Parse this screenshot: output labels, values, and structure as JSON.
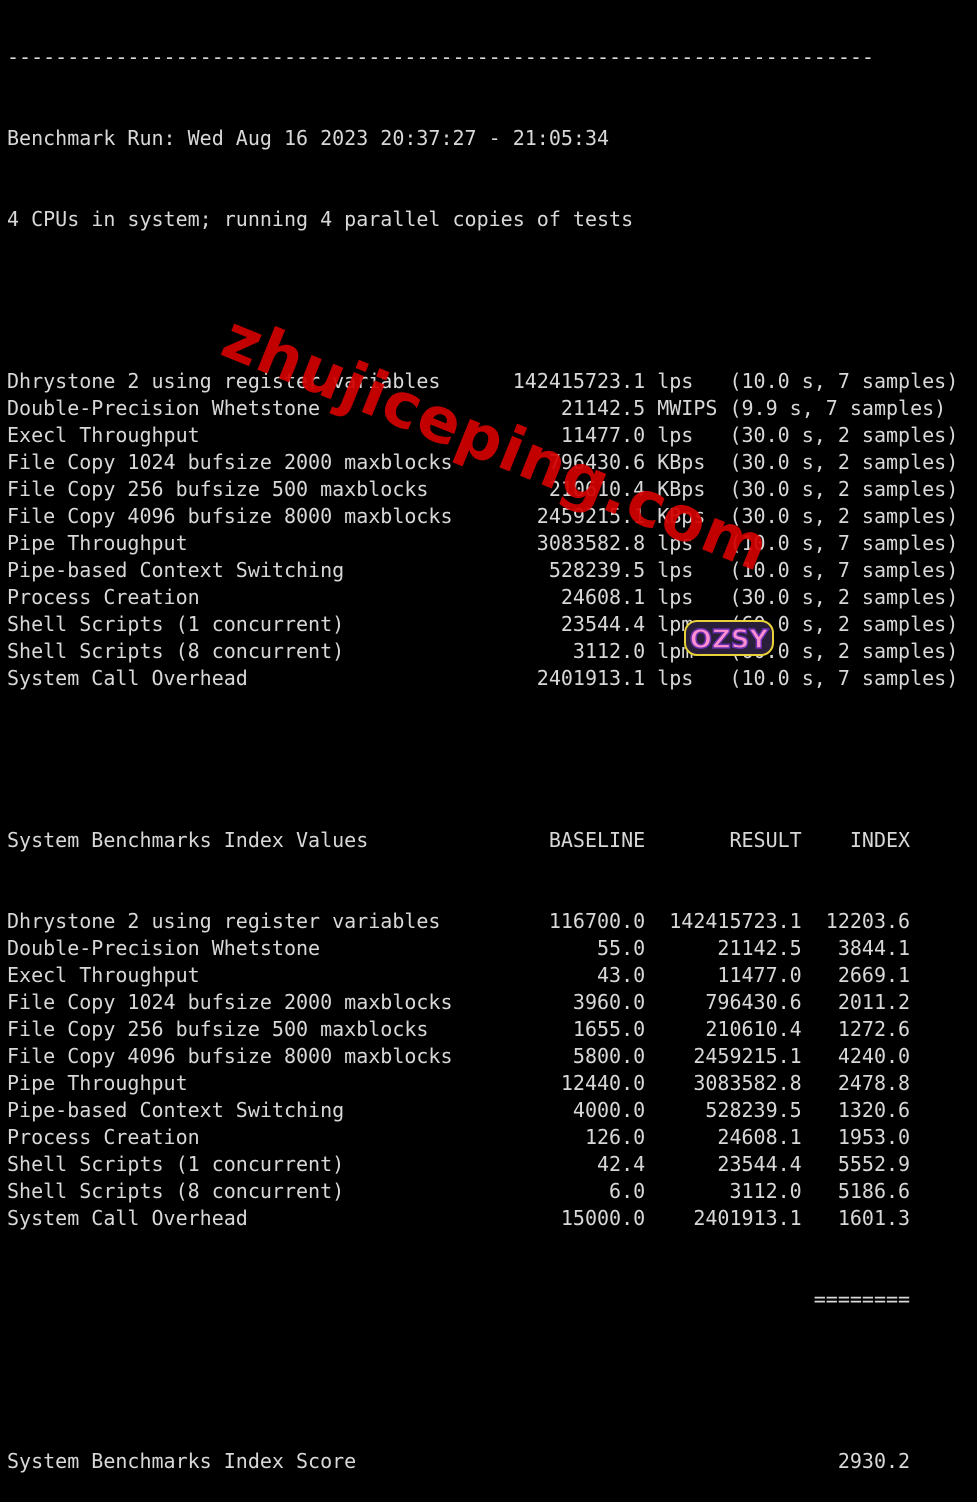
{
  "terminal": {
    "separator": "------------------------------------------------------------------------",
    "header": [
      "Benchmark Run: Wed Aug 16 2023 20:37:27 - 21:05:34",
      "4 CPUs in system; running 4 parallel copies of tests"
    ],
    "results": [
      {
        "name": "Dhrystone 2 using register variables",
        "value": "142415723.1",
        "unit": "lps",
        "info": "(10.0 s, 7 samples)"
      },
      {
        "name": "Double-Precision Whetstone",
        "value": "21142.5",
        "unit": "MWIPS",
        "info": "(9.9 s, 7 samples)"
      },
      {
        "name": "Execl Throughput",
        "value": "11477.0",
        "unit": "lps",
        "info": "(30.0 s, 2 samples)"
      },
      {
        "name": "File Copy 1024 bufsize 2000 maxblocks",
        "value": "796430.6",
        "unit": "KBps",
        "info": "(30.0 s, 2 samples)"
      },
      {
        "name": "File Copy 256 bufsize 500 maxblocks",
        "value": "210610.4",
        "unit": "KBps",
        "info": "(30.0 s, 2 samples)"
      },
      {
        "name": "File Copy 4096 bufsize 8000 maxblocks",
        "value": "2459215.1",
        "unit": "KBps",
        "info": "(30.0 s, 2 samples)"
      },
      {
        "name": "Pipe Throughput",
        "value": "3083582.8",
        "unit": "lps",
        "info": "(10.0 s, 7 samples)"
      },
      {
        "name": "Pipe-based Context Switching",
        "value": "528239.5",
        "unit": "lps",
        "info": "(10.0 s, 7 samples)"
      },
      {
        "name": "Process Creation",
        "value": "24608.1",
        "unit": "lps",
        "info": "(30.0 s, 2 samples)"
      },
      {
        "name": "Shell Scripts (1 concurrent)",
        "value": "23544.4",
        "unit": "lpm",
        "info": "(60.0 s, 2 samples)"
      },
      {
        "name": "Shell Scripts (8 concurrent)",
        "value": "3112.0",
        "unit": "lpm",
        "info": "(60.0 s, 2 samples)"
      },
      {
        "name": "System Call Overhead",
        "value": "2401913.1",
        "unit": "lps",
        "info": "(10.0 s, 7 samples)"
      }
    ],
    "index_title": "System Benchmarks Index Values",
    "index_columns": [
      "BASELINE",
      "RESULT",
      "INDEX"
    ],
    "index_rows": [
      {
        "name": "Dhrystone 2 using register variables",
        "baseline": "116700.0",
        "result": "142415723.1",
        "index": "12203.6"
      },
      {
        "name": "Double-Precision Whetstone",
        "baseline": "55.0",
        "result": "21142.5",
        "index": "3844.1"
      },
      {
        "name": "Execl Throughput",
        "baseline": "43.0",
        "result": "11477.0",
        "index": "2669.1"
      },
      {
        "name": "File Copy 1024 bufsize 2000 maxblocks",
        "baseline": "3960.0",
        "result": "796430.6",
        "index": "2011.2"
      },
      {
        "name": "File Copy 256 bufsize 500 maxblocks",
        "baseline": "1655.0",
        "result": "210610.4",
        "index": "1272.6"
      },
      {
        "name": "File Copy 4096 bufsize 8000 maxblocks",
        "baseline": "5800.0",
        "result": "2459215.1",
        "index": "4240.0"
      },
      {
        "name": "Pipe Throughput",
        "baseline": "12440.0",
        "result": "3083582.8",
        "index": "2478.8"
      },
      {
        "name": "Pipe-based Context Switching",
        "baseline": "4000.0",
        "result": "528239.5",
        "index": "1320.6"
      },
      {
        "name": "Process Creation",
        "baseline": "126.0",
        "result": "24608.1",
        "index": "1953.0"
      },
      {
        "name": "Shell Scripts (1 concurrent)",
        "baseline": "42.4",
        "result": "23544.4",
        "index": "5552.9"
      },
      {
        "name": "Shell Scripts (8 concurrent)",
        "baseline": "6.0",
        "result": "3112.0",
        "index": "5186.6"
      },
      {
        "name": "System Call Overhead",
        "baseline": "15000.0",
        "result": "2401913.1",
        "index": "1601.3"
      }
    ],
    "score_rule": "========",
    "score_label": "System Benchmarks Index Score",
    "score_value": "2930.2"
  },
  "watermark": {
    "text": "zhujiceping.com",
    "color": "#d40000"
  },
  "logo": {
    "text": "OZSY",
    "icon": "ozsy-logo"
  }
}
